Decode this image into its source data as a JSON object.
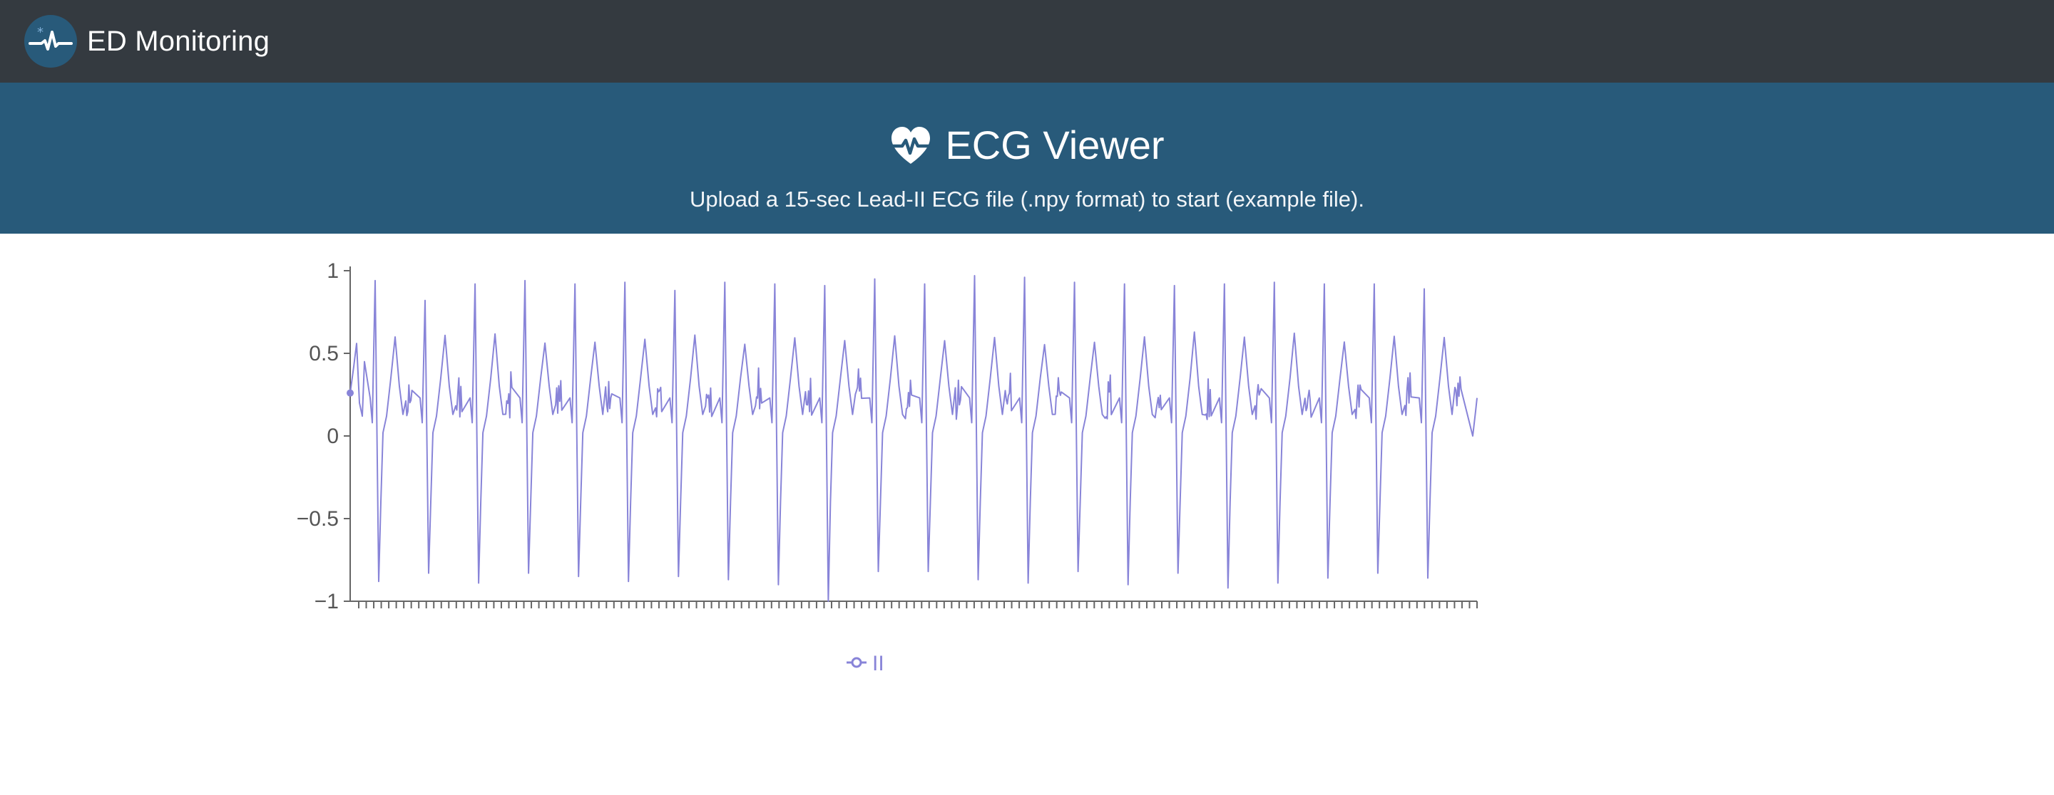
{
  "navbar": {
    "brand": "ED Monitoring",
    "logo_icon": "ecg-pulse-logo-icon"
  },
  "banner": {
    "icon": "heart-pulse-icon",
    "title": "ECG Viewer",
    "subtitle": "Upload a 15-sec Lead-II ECG file (.npy format) to start (example file)."
  },
  "colors": {
    "navbar_bg": "#343a40",
    "banner_bg": "#285a7a",
    "series": "#8884d8"
  },
  "chart_data": {
    "type": "line",
    "title": "",
    "xlabel": "",
    "ylabel": "",
    "ylim": [
      -1,
      1
    ],
    "y_ticks": [
      1,
      0.5,
      0,
      -0.5,
      -1
    ],
    "y_tick_labels": [
      "1",
      "0.5",
      "0",
      "−0.5",
      "−1"
    ],
    "x_tick_count": 150,
    "x_tick_labels_shown": false,
    "grid": false,
    "legend_position": "bottom",
    "series": [
      {
        "name": "II",
        "color": "#8884d8",
        "start_value": 0.26,
        "beats": 22,
        "r_peak_values": [
          0.94,
          0.82,
          0.92,
          0.94,
          0.92,
          0.93,
          0.88,
          0.93,
          0.92,
          0.91,
          0.95,
          0.92,
          0.97,
          0.96,
          0.93,
          0.92,
          0.91,
          0.92,
          0.93,
          0.92,
          0.92,
          0.89
        ],
        "s_trough_values": [
          -0.88,
          -0.83,
          -0.89,
          -0.83,
          -0.85,
          -0.88,
          -0.85,
          -0.87,
          -0.9,
          -1.0,
          -0.82,
          -0.82,
          -0.87,
          -0.89,
          -0.82,
          -0.9,
          -0.83,
          -0.92,
          -0.89,
          -0.86,
          -0.83,
          -0.86
        ],
        "baseline_range": [
          0.05,
          0.3
        ],
        "t_wave_peak_range": [
          0.5,
          0.65
        ],
        "end_value": 0.23
      }
    ]
  }
}
